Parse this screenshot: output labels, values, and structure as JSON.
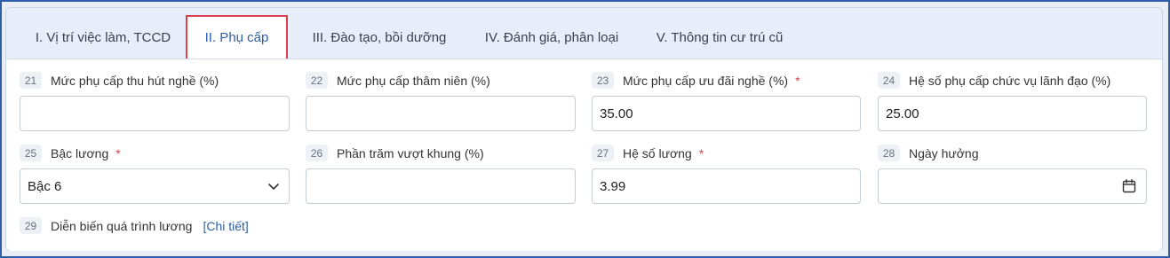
{
  "tabs": [
    {
      "label": "I. Vị trí việc làm, TCCD",
      "active": false
    },
    {
      "label": "II. Phụ cấp",
      "active": true
    },
    {
      "label": "III. Đào tạo, bồi dưỡng",
      "active": false
    },
    {
      "label": "IV. Đánh giá, phân loại",
      "active": false
    },
    {
      "label": "V. Thông tin cư trú cũ",
      "active": false
    }
  ],
  "fields": {
    "f21": {
      "num": "21",
      "label": "Mức phụ cấp thu hút nghề (%)",
      "value": ""
    },
    "f22": {
      "num": "22",
      "label": "Mức phụ cấp thâm niên (%)",
      "value": ""
    },
    "f23": {
      "num": "23",
      "label": "Mức phụ cấp ưu đãi nghề (%)",
      "required": "*",
      "value": "35.00"
    },
    "f24": {
      "num": "24",
      "label": "Hệ số phụ cấp chức vụ lãnh đạo (%)",
      "value": "25.00"
    },
    "f25": {
      "num": "25",
      "label": "Bậc lương",
      "required": "*",
      "value": "Bậc 6"
    },
    "f26": {
      "num": "26",
      "label": "Phần trăm vượt khung (%)",
      "value": ""
    },
    "f27": {
      "num": "27",
      "label": "Hệ số lương",
      "required": "*",
      "value": "3.99"
    },
    "f28": {
      "num": "28",
      "label": "Ngày hưởng",
      "value": ""
    },
    "f29": {
      "num": "29",
      "label": "Diễn biến quá trình lương",
      "link": "[Chi tiết]"
    }
  },
  "icons": {
    "select": "chevron-down-icon",
    "date": "calendar-icon"
  },
  "colors": {
    "accent": "#2d5fa8",
    "active_tab_border": "#d9414e",
    "required": "#d9414e"
  }
}
